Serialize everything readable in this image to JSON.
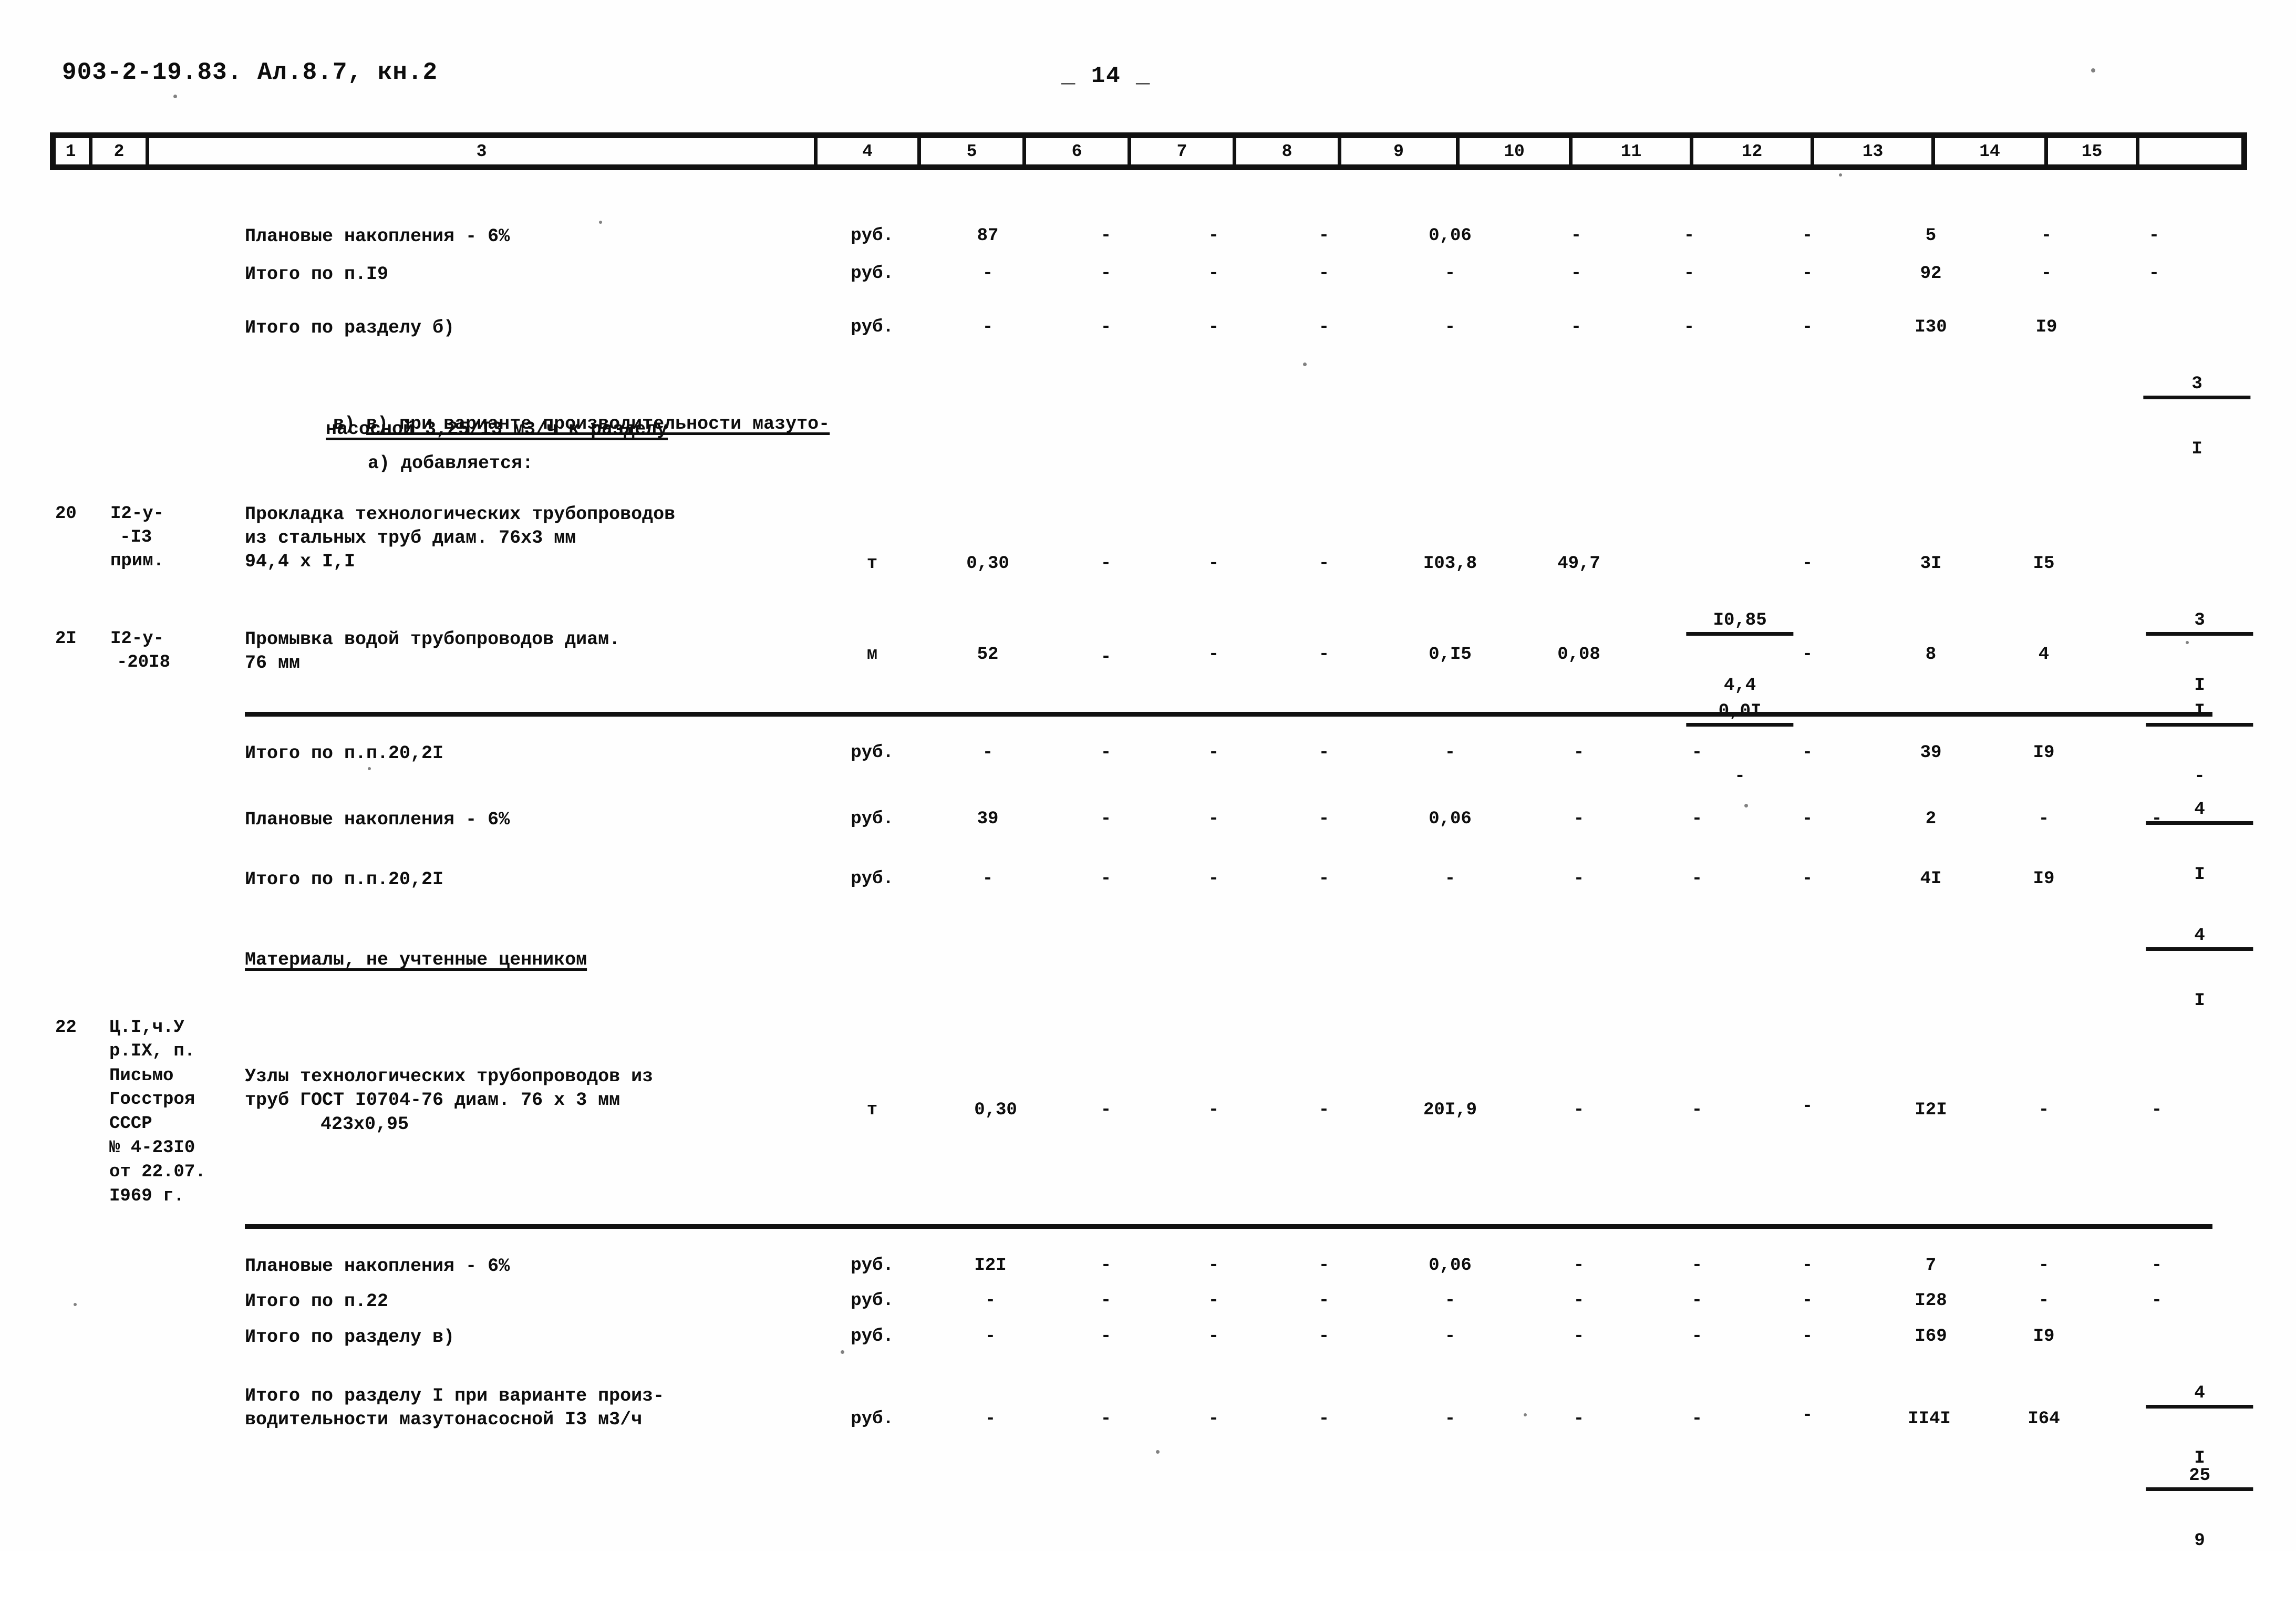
{
  "document": {
    "header_code": "903-2-19.83. Ал.8.7, кн.2",
    "page_number": "_ 14 _"
  },
  "table": {
    "column_headers": [
      "1",
      "2",
      "3",
      "4",
      "5",
      "6",
      "7",
      "8",
      "9",
      "10",
      "11",
      "12",
      "13",
      "14",
      "15"
    ],
    "dash": "-",
    "unit_rub": "руб.",
    "unit_t": "т",
    "unit_m": "м",
    "rows": [
      {
        "id": "row-planovye-nakopleniya-1",
        "c3": "Плановые накопления - 6%",
        "c4": "руб.",
        "c5": "87",
        "c6": "-",
        "c7": "-",
        "c8": "-",
        "c9": "0,06",
        "c10": "-",
        "c11": "-",
        "c12": "-",
        "c13": "5",
        "c14": "-",
        "c15": "-"
      },
      {
        "id": "row-itogo-p19",
        "c3": "Итого по п.I9",
        "c4": "руб.",
        "c5": "-",
        "c6": "-",
        "c7": "-",
        "c8": "-",
        "c9": "-",
        "c10": "-",
        "c11": "-",
        "c12": "-",
        "c13": "92",
        "c14": "-",
        "c15": "-"
      },
      {
        "id": "row-itogo-razdel-b",
        "c3": "Итого по разделу б)",
        "c4": "руб.",
        "c5": "-",
        "c6": "-",
        "c7": "-",
        "c8": "-",
        "c9": "-",
        "c10": "-",
        "c11": "-",
        "c12": "-",
        "c13": "I30",
        "c14": "I9",
        "c15_top": "3",
        "c15_bot": "I"
      },
      {
        "id": "row-20",
        "c1": "20",
        "c2_l1": "I2-у-",
        "c2_l2": "-I3",
        "c2_l3": "прим.",
        "c3_l1": "Прокладка технологических трубопроводов",
        "c3_l2": "из стальных труб диам. 76х3 мм",
        "c3_l3": "94,4 х I,I",
        "c4": "т",
        "c5": "0,30",
        "c6": "-",
        "c7": "-",
        "c8": "-",
        "c9": "I03,8",
        "c10": "49,7",
        "c11_top": "I0,85",
        "c11_bot": "4,4",
        "c12": "-",
        "c13": "3I",
        "c14": "I5",
        "c15_top": "3",
        "c15_bot": "I"
      },
      {
        "id": "row-21",
        "c1": "2I",
        "c2_l1": "I2-у-",
        "c2_l2": "-20I8",
        "c3_l1": "Промывка водой трубопроводов диам.",
        "c3_l2": "76 мм",
        "c4": "м",
        "c5": "52",
        "c6": "-",
        "c7": "-",
        "c8": "-",
        "c9": "0,I5",
        "c10": "0,08",
        "c11_top": "0,0I",
        "c11_bot": "-",
        "c12": "-",
        "c13": "8",
        "c14": "4",
        "c15_top": "I",
        "c15_bot": "-"
      },
      {
        "id": "row-itogo-pp2021-a",
        "c3": "Итого по п.п.20,2I",
        "c4": "руб.",
        "c5": "-",
        "c6": "-",
        "c7": "-",
        "c8": "-",
        "c9": "-",
        "c10": "-",
        "c11": "-",
        "c12": "-",
        "c13": "39",
        "c14": "I9",
        "c15_top": "4",
        "c15_bot": "I"
      },
      {
        "id": "row-planovye-nakopleniya-2",
        "c3": "Плановые накопления - 6%",
        "c4": "руб.",
        "c5": "39",
        "c6": "-",
        "c7": "-",
        "c8": "-",
        "c9": "0,06",
        "c10": "-",
        "c11": "-",
        "c12": "-",
        "c13": "2",
        "c14": "-",
        "c15": "-"
      },
      {
        "id": "row-itogo-pp2021-b",
        "c3": "Итого по п.п.20,2I",
        "c4": "руб.",
        "c5": "-",
        "c6": "-",
        "c7": "-",
        "c8": "-",
        "c9": "-",
        "c10": "-",
        "c11": "-",
        "c12": "-",
        "c13": "4I",
        "c14": "I9",
        "c15_top": "4",
        "c15_bot": "I"
      },
      {
        "id": "row-22",
        "c1": "22",
        "c2_l1": "Ц.I,ч.У",
        "c2_l2": "р.IХ, п.",
        "c2_l3": "Письмо",
        "c2_l4": "Госстроя",
        "c2_l5": "СССР",
        "c2_l6": "№ 4-23I0",
        "c2_l7": "от 22.07.",
        "c2_l8": "I969 г.",
        "c3_l1": "Узлы технологических трубопроводов из",
        "c3_l2": "труб ГОСТ I0704-76 диам. 76 х 3 мм",
        "c3_l3": "423х0,95",
        "c4": "т",
        "c5": "0,30",
        "c6": "-",
        "c7": "-",
        "c8": "-",
        "c9": "20I,9",
        "c10": "-",
        "c11": "-",
        "c12": "-",
        "c13": "I2I",
        "c14": "-",
        "c15": "-"
      },
      {
        "id": "row-planovye-nakopleniya-3",
        "c3": "Плановые накопления - 6%",
        "c4": "руб.",
        "c5": "I2I",
        "c6": "-",
        "c7": "-",
        "c8": "-",
        "c9": "0,06",
        "c10": "-",
        "c11": "-",
        "c12": "-",
        "c13": "7",
        "c14": "-",
        "c15": "-"
      },
      {
        "id": "row-itogo-p22",
        "c3": "Итого по п.22",
        "c4": "руб.",
        "c5": "-",
        "c6": "-",
        "c7": "-",
        "c8": "-",
        "c9": "-",
        "c10": "-",
        "c11": "-",
        "c12": "-",
        "c13": "I28",
        "c14": "-",
        "c15": "-"
      },
      {
        "id": "row-itogo-razdel-v",
        "c3": "Итого по разделу в)",
        "c4": "руб.",
        "c5": "-",
        "c6": "-",
        "c7": "-",
        "c8": "-",
        "c9": "-",
        "c10": "-",
        "c11": "-",
        "c12": "-",
        "c13": "I69",
        "c14": "I9",
        "c15_top": "4",
        "c15_bot": "I"
      },
      {
        "id": "row-itogo-razdel-1",
        "c3_l1": "Итого по разделу I при варианте произ-",
        "c3_l2": "водительности мазутонасосной I3 м3/ч",
        "c4": "руб.",
        "c5": "-",
        "c6": "-",
        "c7": "-",
        "c8": "-",
        "c9": "-",
        "c10": "-",
        "c11": "-",
        "c12": "-",
        "c13": "II4I",
        "c14": "I64",
        "c15_top": "25",
        "c15_bot": "9"
      }
    ]
  },
  "section_headings": {
    "variant_line1": "в) при варианте производительности мазуто-",
    "variant_line2": "насосной 3,25/I3 м3/ч к разделу",
    "variant_line3": "а) добавляется:",
    "materials": "Материалы, не учтенные ценником"
  }
}
